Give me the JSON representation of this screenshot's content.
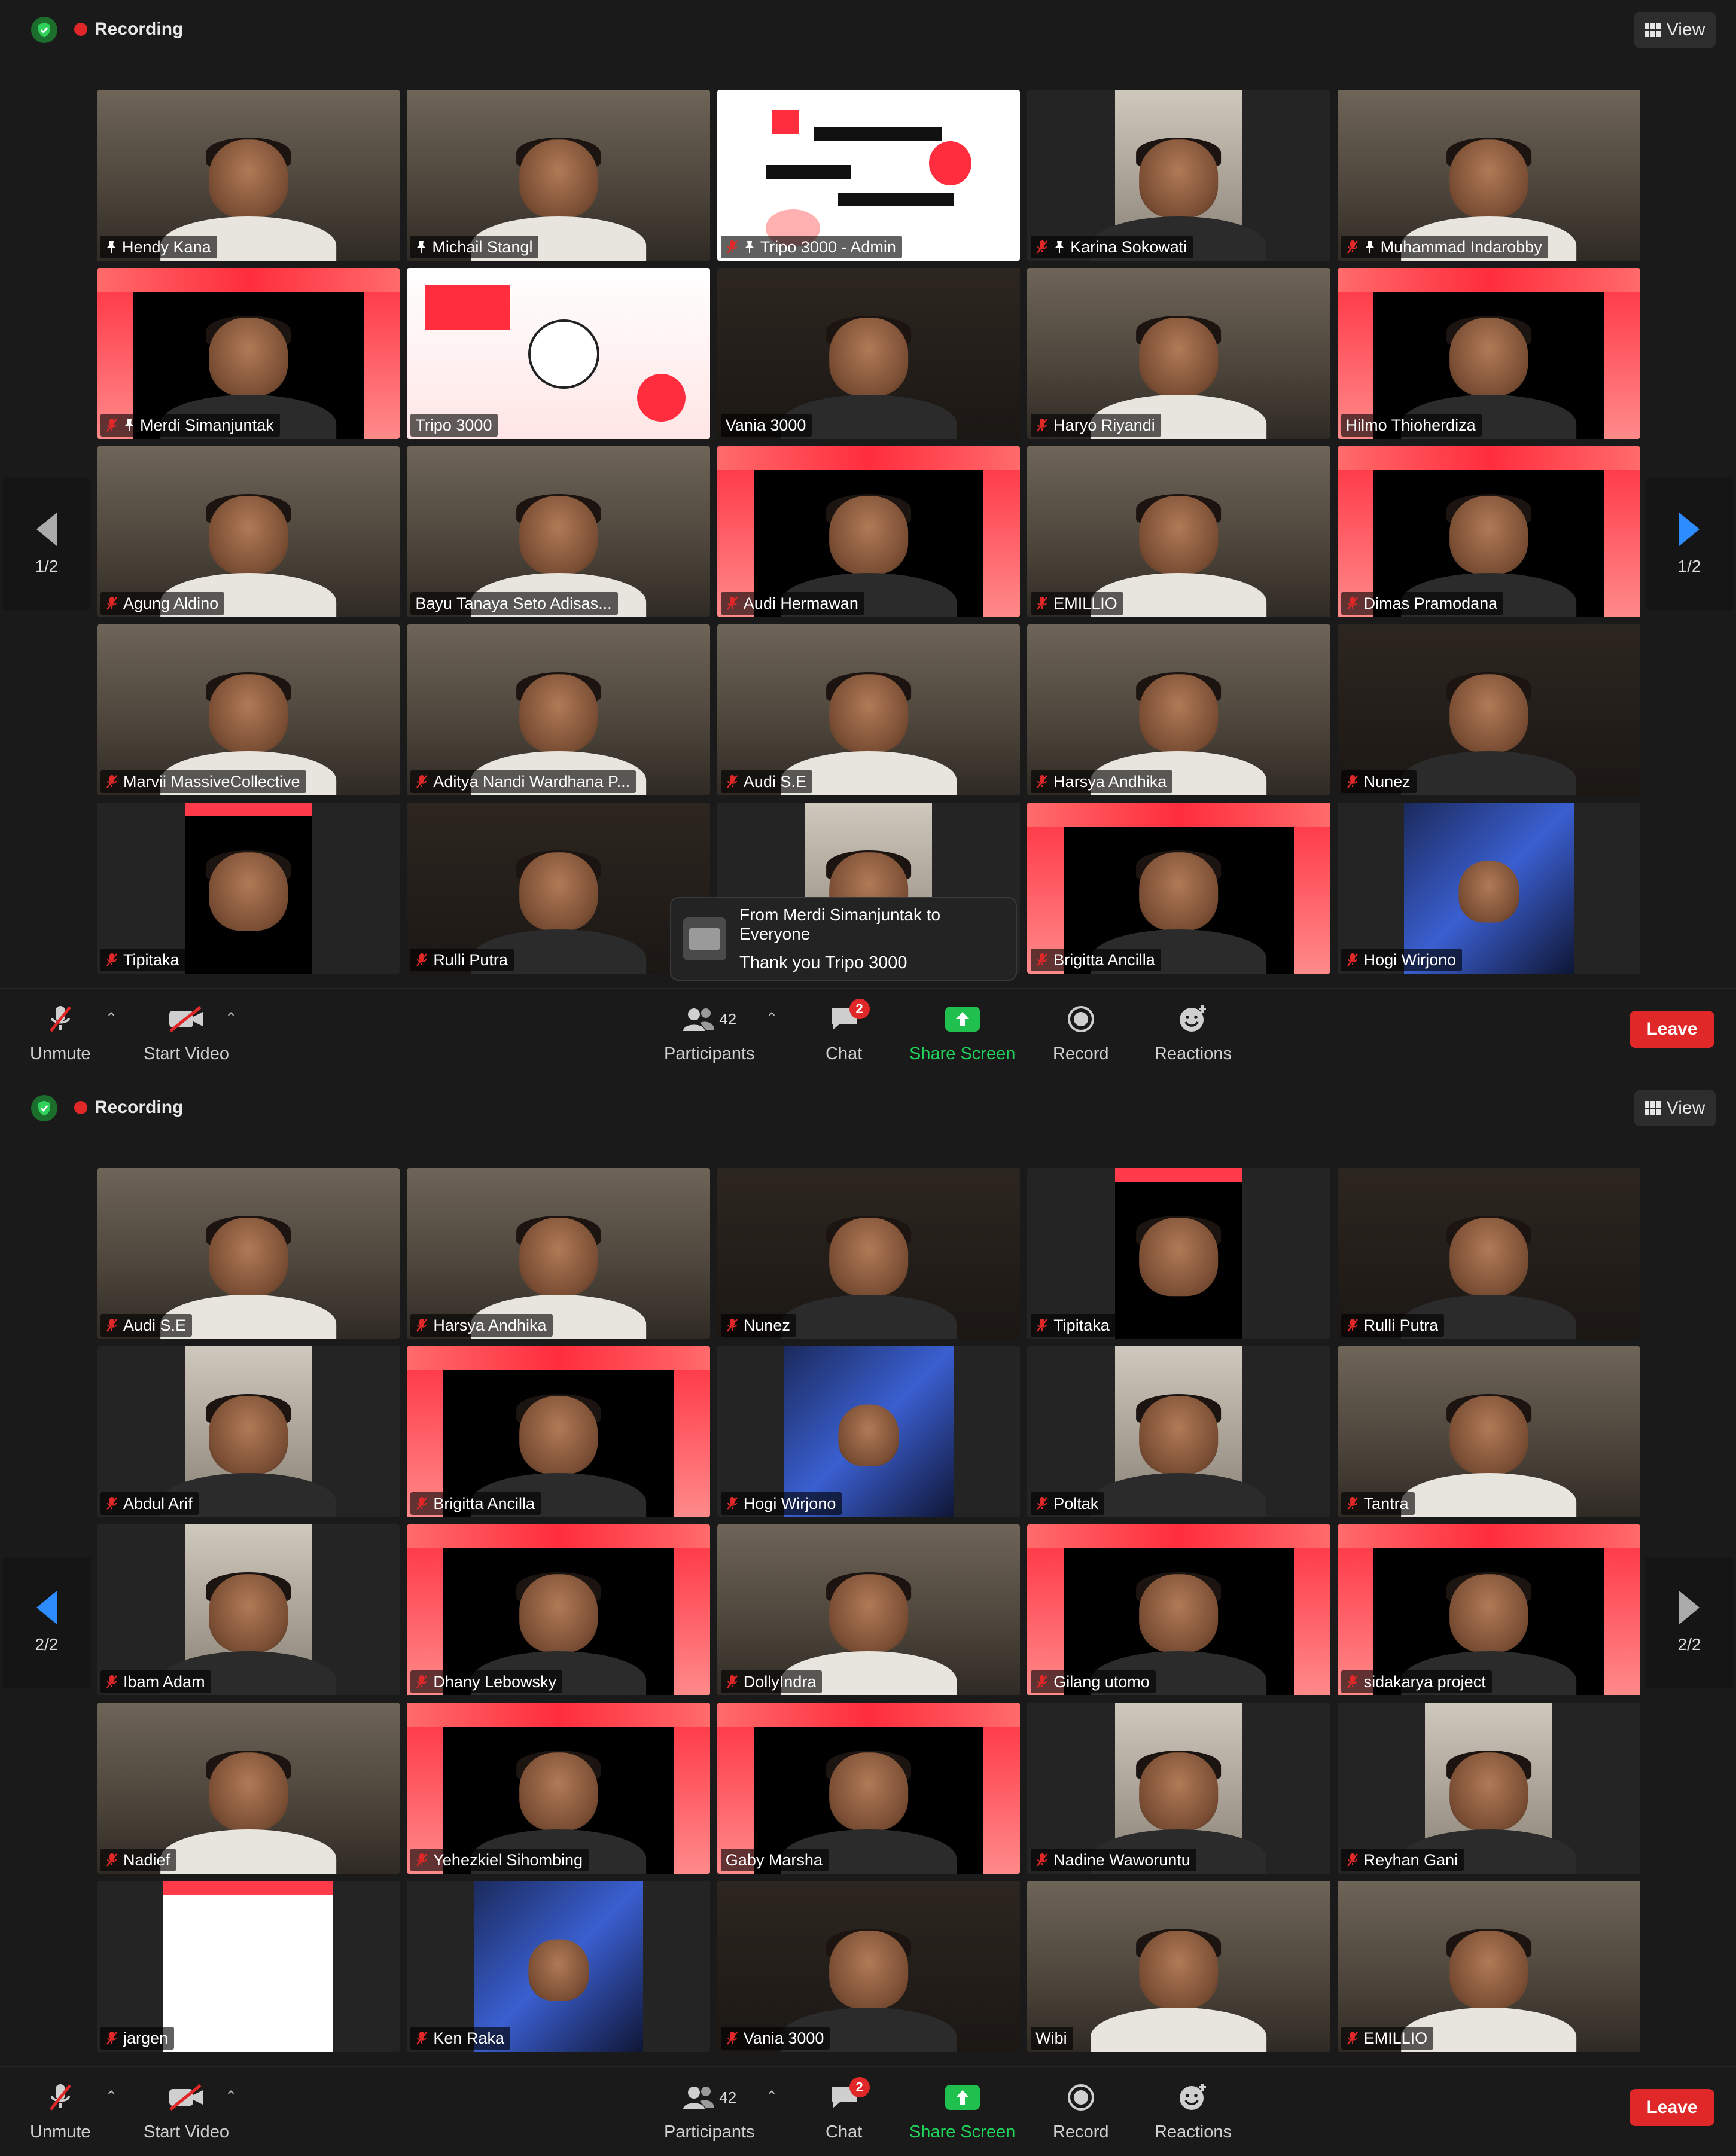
{
  "colors": {
    "accent": "#2d8cff",
    "leave": "#e02828",
    "share": "#20c04f",
    "active_speaker": "#c5e635"
  },
  "screens": [
    {
      "recording_label": "Recording",
      "view_label": "View",
      "page_indicator": "1/2",
      "tiles": [
        {
          "name": "Hendy Kana",
          "pinned": true,
          "muted": false,
          "active": true,
          "style": "room"
        },
        {
          "name": "Michail Stangl",
          "pinned": true,
          "muted": false,
          "style": "room"
        },
        {
          "name": "Tripo 3000 - Admin",
          "pinned": true,
          "muted": true,
          "style": "poster"
        },
        {
          "name": "Karina Sokowati",
          "pinned": true,
          "muted": true,
          "style": "narrow"
        },
        {
          "name": "Muhammad Indarobby",
          "pinned": true,
          "muted": true,
          "style": "room"
        },
        {
          "name": "Merdi Simanjuntak",
          "pinned": true,
          "muted": true,
          "style": "banner"
        },
        {
          "name": "Tripo 3000",
          "pinned": false,
          "muted": false,
          "style": "boiler"
        },
        {
          "name": "Vania 3000",
          "pinned": false,
          "muted": false,
          "style": "dark"
        },
        {
          "name": "Haryo Riyandi",
          "pinned": false,
          "muted": true,
          "style": "room"
        },
        {
          "name": "Hilmo Thioherdiza",
          "pinned": false,
          "muted": false,
          "style": "banner"
        },
        {
          "name": "Agung Aldino",
          "pinned": false,
          "muted": true,
          "style": "room"
        },
        {
          "name": "Bayu Tanaya Seto Adisas...",
          "pinned": false,
          "muted": false,
          "style": "room"
        },
        {
          "name": "Audi Hermawan",
          "pinned": false,
          "muted": true,
          "style": "banner"
        },
        {
          "name": "EMILLIO",
          "pinned": false,
          "muted": true,
          "style": "room"
        },
        {
          "name": "Dimas Pramodana",
          "pinned": false,
          "muted": true,
          "style": "banner"
        },
        {
          "name": "Marvii MassiveCollective",
          "pinned": false,
          "muted": true,
          "style": "room"
        },
        {
          "name": "Aditya Nandi Wardhana P...",
          "pinned": false,
          "muted": true,
          "style": "room"
        },
        {
          "name": "Audi S.E",
          "pinned": false,
          "muted": true,
          "style": "room"
        },
        {
          "name": "Harsya Andhika",
          "pinned": false,
          "muted": true,
          "style": "room"
        },
        {
          "name": "Nunez",
          "pinned": false,
          "muted": true,
          "style": "dark"
        },
        {
          "name": "Tipitaka",
          "pinned": false,
          "muted": true,
          "style": "narrowbanner"
        },
        {
          "name": "Rulli Putra",
          "pinned": false,
          "muted": true,
          "style": "dark"
        },
        {
          "name": "",
          "pinned": false,
          "muted": false,
          "style": "narrow"
        },
        {
          "name": "Brigitta Ancilla",
          "pinned": false,
          "muted": true,
          "style": "banner"
        },
        {
          "name": "Hogi Wirjono",
          "pinned": false,
          "muted": true,
          "style": "narrowdark"
        }
      ],
      "chat_popup": {
        "from": "From Merdi Simanjuntak to Everyone",
        "message": "Thank you Tripo 3000"
      },
      "toolbar": {
        "unmute": "Unmute",
        "start_video": "Start Video",
        "participants": "Participants",
        "participants_count": "42",
        "chat": "Chat",
        "chat_badge": "2",
        "share_screen": "Share Screen",
        "record": "Record",
        "reactions": "Reactions",
        "leave": "Leave"
      }
    },
    {
      "recording_label": "Recording",
      "view_label": "View",
      "page_indicator": "2/2",
      "tiles": [
        {
          "name": "Audi S.E",
          "pinned": false,
          "muted": true,
          "style": "room"
        },
        {
          "name": "Harsya Andhika",
          "pinned": false,
          "muted": true,
          "style": "room"
        },
        {
          "name": "Nunez",
          "pinned": false,
          "muted": true,
          "style": "dark"
        },
        {
          "name": "Tipitaka",
          "pinned": false,
          "muted": true,
          "style": "narrowbanner"
        },
        {
          "name": "Rulli Putra",
          "pinned": false,
          "muted": true,
          "style": "dark"
        },
        {
          "name": "Abdul Arif",
          "pinned": false,
          "muted": true,
          "style": "narrow"
        },
        {
          "name": "Brigitta Ancilla",
          "pinned": false,
          "muted": true,
          "style": "banner"
        },
        {
          "name": "Hogi Wirjono",
          "pinned": false,
          "muted": true,
          "style": "narrowdark"
        },
        {
          "name": "Poltak",
          "pinned": false,
          "muted": true,
          "style": "narrow"
        },
        {
          "name": "Tantra",
          "pinned": false,
          "muted": true,
          "style": "room"
        },
        {
          "name": "Ibam Adam",
          "pinned": false,
          "muted": true,
          "style": "narrow"
        },
        {
          "name": "Dhany Lebowsky",
          "pinned": false,
          "muted": true,
          "style": "banner"
        },
        {
          "name": "DollyIndra",
          "pinned": false,
          "muted": true,
          "style": "room"
        },
        {
          "name": "Gilang utomo",
          "pinned": false,
          "muted": true,
          "style": "banner"
        },
        {
          "name": "sidakarya project",
          "pinned": false,
          "muted": true,
          "style": "banner"
        },
        {
          "name": "Nadief",
          "pinned": false,
          "muted": true,
          "style": "room"
        },
        {
          "name": "Yehezkiel Sihombing",
          "pinned": false,
          "muted": true,
          "style": "banner"
        },
        {
          "name": "Gaby Marsha",
          "pinned": false,
          "muted": false,
          "style": "banner"
        },
        {
          "name": "Nadine Waworuntu",
          "pinned": false,
          "muted": true,
          "style": "narrow"
        },
        {
          "name": "Reyhan Gani",
          "pinned": false,
          "muted": true,
          "style": "narrow"
        },
        {
          "name": "jargen",
          "pinned": false,
          "muted": true,
          "style": "whitebanner"
        },
        {
          "name": "Ken Raka",
          "pinned": false,
          "muted": true,
          "style": "narrowdark"
        },
        {
          "name": "Vania 3000",
          "pinned": false,
          "muted": true,
          "style": "dark"
        },
        {
          "name": "Wibi",
          "pinned": false,
          "muted": false,
          "style": "room"
        },
        {
          "name": "EMILLIO",
          "pinned": false,
          "muted": true,
          "style": "room"
        }
      ],
      "toolbar": {
        "unmute": "Unmute",
        "start_video": "Start Video",
        "participants": "Participants",
        "participants_count": "42",
        "chat": "Chat",
        "chat_badge": "2",
        "share_screen": "Share Screen",
        "record": "Record",
        "reactions": "Reactions",
        "leave": "Leave"
      }
    }
  ]
}
